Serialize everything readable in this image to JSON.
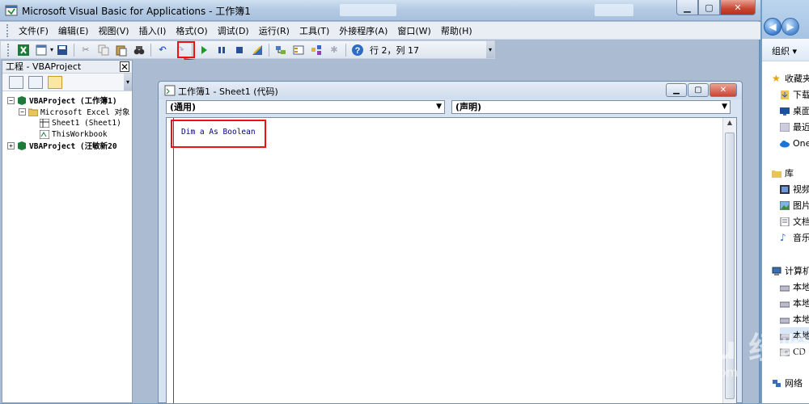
{
  "window": {
    "title": "Microsoft Visual Basic for Applications - 工作簿1"
  },
  "menu": [
    {
      "label": "文件(F)"
    },
    {
      "label": "编辑(E)"
    },
    {
      "label": "视图(V)"
    },
    {
      "label": "插入(I)"
    },
    {
      "label": "格式(O)"
    },
    {
      "label": "调试(D)"
    },
    {
      "label": "运行(R)"
    },
    {
      "label": "工具(T)"
    },
    {
      "label": "外接程序(A)"
    },
    {
      "label": "窗口(W)"
    },
    {
      "label": "帮助(H)"
    }
  ],
  "toolbar": {
    "position_label": "行 2，列 17"
  },
  "project": {
    "title": "工程 - VBAProject",
    "tree": [
      {
        "label": "VBAProject (工作簿1)",
        "bold": true,
        "expander": "−"
      },
      {
        "label": "Microsoft Excel 对象",
        "bold": false,
        "expander": "−"
      },
      {
        "label": "Sheet1 (Sheet1)",
        "bold": false,
        "expander": ""
      },
      {
        "label": "ThisWorkbook",
        "bold": false,
        "expander": ""
      },
      {
        "label": "VBAProject (汪敏新20",
        "bold": true,
        "expander": "+"
      }
    ]
  },
  "code_window": {
    "title": "工作簿1 - Sheet1 (代码)",
    "object_combo": "(通用)",
    "proc_combo": "(声明)",
    "code_keyword_1": "Dim",
    "code_var": "a",
    "code_keyword_2": "As Boolean"
  },
  "explorer": {
    "organize": "组织 ▾",
    "items": [
      {
        "label": "收藏夹",
        "icon": "star-icon"
      },
      {
        "label": "下载",
        "icon": "download-icon"
      },
      {
        "label": "桌面",
        "icon": "desktop-icon"
      },
      {
        "label": "最近",
        "icon": "recent-icon"
      },
      {
        "label": "OneDrive",
        "icon": "cloud-icon"
      },
      {
        "label": "库",
        "icon": "library-icon"
      },
      {
        "label": "视频",
        "icon": "video-icon"
      },
      {
        "label": "图片",
        "icon": "picture-icon"
      },
      {
        "label": "文档",
        "icon": "document-icon"
      },
      {
        "label": "音乐",
        "icon": "music-icon"
      },
      {
        "label": "计算机",
        "icon": "computer-icon"
      },
      {
        "label": "本地",
        "icon": "drive-icon"
      },
      {
        "label": "本地",
        "icon": "drive-icon"
      },
      {
        "label": "本地",
        "icon": "drive-icon"
      },
      {
        "label": "本地",
        "icon": "drive-icon"
      },
      {
        "label": "CD",
        "icon": "cd-icon"
      },
      {
        "label": "网络",
        "icon": "network-icon"
      }
    ]
  },
  "watermark": {
    "brand": "Bai du 经验",
    "url": "jingyan.baidu.com"
  },
  "colors": {
    "highlight": "#ee1111",
    "keyword": "#00008b"
  }
}
